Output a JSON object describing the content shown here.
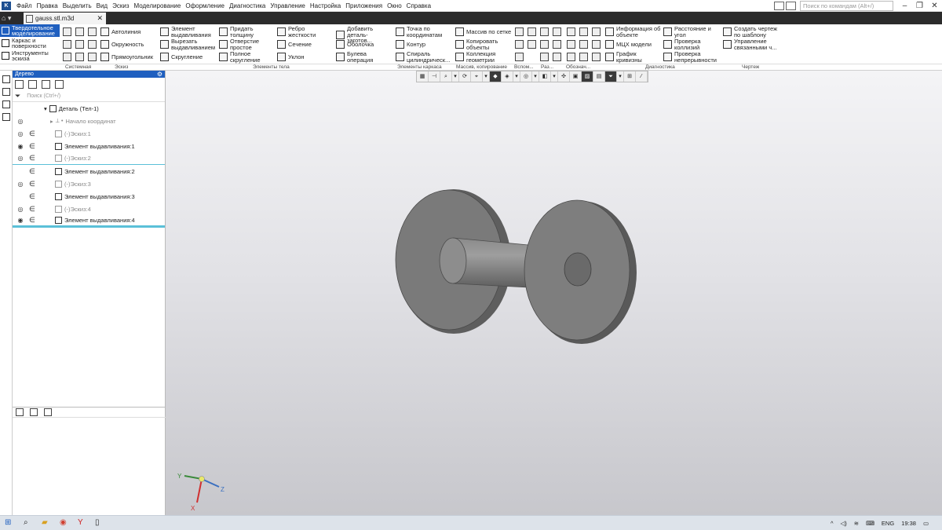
{
  "app": {
    "logo": "K"
  },
  "menu": [
    "Файл",
    "Правка",
    "Выделить",
    "Вид",
    "Эскиз",
    "Моделирование",
    "Оформление",
    "Диагностика",
    "Управление",
    "Настройка",
    "Приложения",
    "Окно",
    "Справка"
  ],
  "command_search": {
    "placeholder": "Поиск по командам (Alt+/)"
  },
  "document_tab": {
    "title": "gauss.stl.m3d"
  },
  "modes": [
    "Твердотельное моделирование",
    "Каркас и поверхности",
    "Инструменты эскиза"
  ],
  "ribbon": {
    "sketch": [
      "Автолиния",
      "Окружность",
      "Прямоугольник"
    ],
    "body_elements": [
      "Элемент выдавливания",
      "Вырезать выдавливанием",
      "Скругление",
      "Придать толщину",
      "Отверстие простое",
      "Полное скругление",
      "Ребро жесткости",
      "Сечение",
      "Уклон",
      "Добавить деталь-заготов...",
      "Оболочка",
      "Булева операция"
    ],
    "frame": [
      "Точка по координатам",
      "Контур",
      "Спираль цилиндрическ..."
    ],
    "array": [
      "Массив по сетке",
      "Копировать объекты",
      "Коллекция геометрии"
    ],
    "diag": [
      "Информация об объекте",
      "МЦХ модели",
      "График кривизны",
      "Расстояние и угол",
      "Проверка коллизий",
      "Проверка непрерывности"
    ],
    "drawing": [
      "Создать чертеж по шаблону",
      "Управление связанными ч..."
    ],
    "group_labels": [
      "Системная",
      "Эскиз",
      "Элементы тела",
      "Элементы каркаса",
      "Массив, копирование",
      "Вспом...",
      "Раз...",
      "Обознач...",
      "Диагностика",
      "Чертеж"
    ]
  },
  "tree": {
    "title": "Дерево",
    "search_placeholder": "Поиск (Ctrl+/)",
    "items": [
      {
        "label": "Деталь (Тел-1)"
      },
      {
        "label": "Начало координат"
      },
      {
        "label": "(-)Эскиз:1"
      },
      {
        "label": "Элемент выдавливания:1"
      },
      {
        "label": "(-)Эскиз:2"
      },
      {
        "label": "Элемент выдавливания:2"
      },
      {
        "label": "(-)Эскиз:3"
      },
      {
        "label": "Элемент выдавливания:3"
      },
      {
        "label": "(-)Эскиз:4"
      },
      {
        "label": "Элемент выдавливания:4"
      }
    ]
  },
  "axes": {
    "x": "X",
    "y": "Y",
    "z": "Z"
  },
  "taskbar": {
    "lang": "ENG",
    "time": "19:38"
  }
}
